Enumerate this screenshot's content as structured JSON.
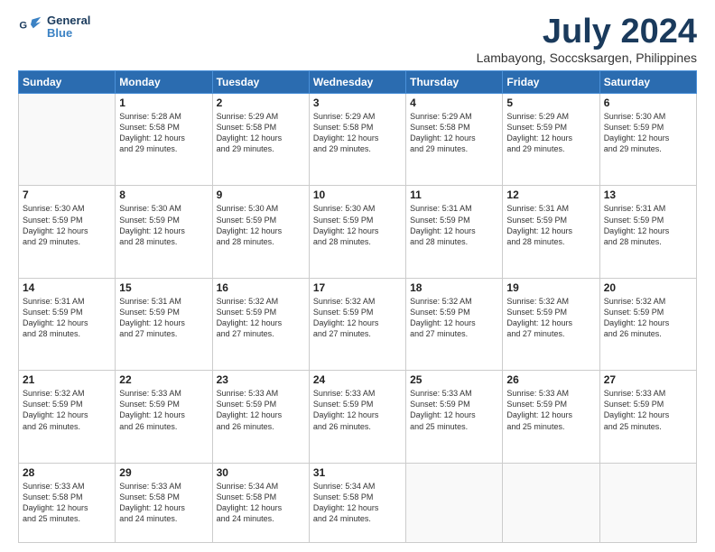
{
  "header": {
    "logo_line1": "General",
    "logo_line2": "Blue",
    "month": "July 2024",
    "location": "Lambayong, Soccsksargen, Philippines"
  },
  "weekdays": [
    "Sunday",
    "Monday",
    "Tuesday",
    "Wednesday",
    "Thursday",
    "Friday",
    "Saturday"
  ],
  "weeks": [
    [
      {
        "day": "",
        "info": ""
      },
      {
        "day": "1",
        "info": "Sunrise: 5:28 AM\nSunset: 5:58 PM\nDaylight: 12 hours\nand 29 minutes."
      },
      {
        "day": "2",
        "info": "Sunrise: 5:29 AM\nSunset: 5:58 PM\nDaylight: 12 hours\nand 29 minutes."
      },
      {
        "day": "3",
        "info": "Sunrise: 5:29 AM\nSunset: 5:58 PM\nDaylight: 12 hours\nand 29 minutes."
      },
      {
        "day": "4",
        "info": "Sunrise: 5:29 AM\nSunset: 5:58 PM\nDaylight: 12 hours\nand 29 minutes."
      },
      {
        "day": "5",
        "info": "Sunrise: 5:29 AM\nSunset: 5:59 PM\nDaylight: 12 hours\nand 29 minutes."
      },
      {
        "day": "6",
        "info": "Sunrise: 5:30 AM\nSunset: 5:59 PM\nDaylight: 12 hours\nand 29 minutes."
      }
    ],
    [
      {
        "day": "7",
        "info": "Sunrise: 5:30 AM\nSunset: 5:59 PM\nDaylight: 12 hours\nand 29 minutes."
      },
      {
        "day": "8",
        "info": "Sunrise: 5:30 AM\nSunset: 5:59 PM\nDaylight: 12 hours\nand 28 minutes."
      },
      {
        "day": "9",
        "info": "Sunrise: 5:30 AM\nSunset: 5:59 PM\nDaylight: 12 hours\nand 28 minutes."
      },
      {
        "day": "10",
        "info": "Sunrise: 5:30 AM\nSunset: 5:59 PM\nDaylight: 12 hours\nand 28 minutes."
      },
      {
        "day": "11",
        "info": "Sunrise: 5:31 AM\nSunset: 5:59 PM\nDaylight: 12 hours\nand 28 minutes."
      },
      {
        "day": "12",
        "info": "Sunrise: 5:31 AM\nSunset: 5:59 PM\nDaylight: 12 hours\nand 28 minutes."
      },
      {
        "day": "13",
        "info": "Sunrise: 5:31 AM\nSunset: 5:59 PM\nDaylight: 12 hours\nand 28 minutes."
      }
    ],
    [
      {
        "day": "14",
        "info": "Sunrise: 5:31 AM\nSunset: 5:59 PM\nDaylight: 12 hours\nand 28 minutes."
      },
      {
        "day": "15",
        "info": "Sunrise: 5:31 AM\nSunset: 5:59 PM\nDaylight: 12 hours\nand 27 minutes."
      },
      {
        "day": "16",
        "info": "Sunrise: 5:32 AM\nSunset: 5:59 PM\nDaylight: 12 hours\nand 27 minutes."
      },
      {
        "day": "17",
        "info": "Sunrise: 5:32 AM\nSunset: 5:59 PM\nDaylight: 12 hours\nand 27 minutes."
      },
      {
        "day": "18",
        "info": "Sunrise: 5:32 AM\nSunset: 5:59 PM\nDaylight: 12 hours\nand 27 minutes."
      },
      {
        "day": "19",
        "info": "Sunrise: 5:32 AM\nSunset: 5:59 PM\nDaylight: 12 hours\nand 27 minutes."
      },
      {
        "day": "20",
        "info": "Sunrise: 5:32 AM\nSunset: 5:59 PM\nDaylight: 12 hours\nand 26 minutes."
      }
    ],
    [
      {
        "day": "21",
        "info": "Sunrise: 5:32 AM\nSunset: 5:59 PM\nDaylight: 12 hours\nand 26 minutes."
      },
      {
        "day": "22",
        "info": "Sunrise: 5:33 AM\nSunset: 5:59 PM\nDaylight: 12 hours\nand 26 minutes."
      },
      {
        "day": "23",
        "info": "Sunrise: 5:33 AM\nSunset: 5:59 PM\nDaylight: 12 hours\nand 26 minutes."
      },
      {
        "day": "24",
        "info": "Sunrise: 5:33 AM\nSunset: 5:59 PM\nDaylight: 12 hours\nand 26 minutes."
      },
      {
        "day": "25",
        "info": "Sunrise: 5:33 AM\nSunset: 5:59 PM\nDaylight: 12 hours\nand 25 minutes."
      },
      {
        "day": "26",
        "info": "Sunrise: 5:33 AM\nSunset: 5:59 PM\nDaylight: 12 hours\nand 25 minutes."
      },
      {
        "day": "27",
        "info": "Sunrise: 5:33 AM\nSunset: 5:59 PM\nDaylight: 12 hours\nand 25 minutes."
      }
    ],
    [
      {
        "day": "28",
        "info": "Sunrise: 5:33 AM\nSunset: 5:58 PM\nDaylight: 12 hours\nand 25 minutes."
      },
      {
        "day": "29",
        "info": "Sunrise: 5:33 AM\nSunset: 5:58 PM\nDaylight: 12 hours\nand 24 minutes."
      },
      {
        "day": "30",
        "info": "Sunrise: 5:34 AM\nSunset: 5:58 PM\nDaylight: 12 hours\nand 24 minutes."
      },
      {
        "day": "31",
        "info": "Sunrise: 5:34 AM\nSunset: 5:58 PM\nDaylight: 12 hours\nand 24 minutes."
      },
      {
        "day": "",
        "info": ""
      },
      {
        "day": "",
        "info": ""
      },
      {
        "day": "",
        "info": ""
      }
    ]
  ]
}
